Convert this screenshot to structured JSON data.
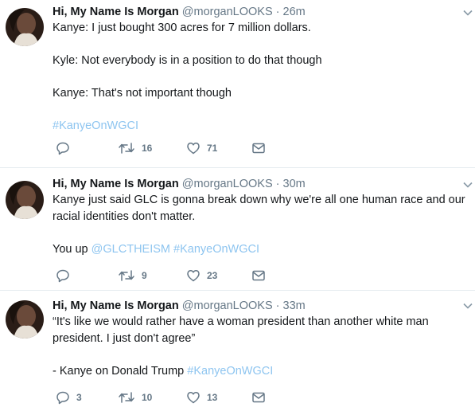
{
  "tweets": [
    {
      "name": "Hi, My Name Is Morgan",
      "handle": "@morganLOOKS",
      "dot": "·",
      "time": "26m",
      "paragraphs": [
        [
          "Kanye: I just bought 300 acres for 7 million dollars."
        ],
        [
          "Kyle: Not everybody is in a position to do that though"
        ],
        [
          "Kanye: That's not important though"
        ]
      ],
      "hashtag_line": "#KanyeOnWGCI",
      "reply_count": "",
      "retweet_count": "16",
      "like_count": "71"
    },
    {
      "name": "Hi, My Name Is Morgan",
      "handle": "@morganLOOKS",
      "dot": "·",
      "time": "30m",
      "line1": "Kanye just said GLC is gonna break down why we're all one human race and our",
      "line2": "racial identities don't matter.",
      "you_up": "You up",
      "mention": "@GLCTHEISM",
      "hashtag": "#KanyeOnWGCI",
      "reply_count": "",
      "retweet_count": "9",
      "like_count": "23"
    },
    {
      "name": "Hi, My Name Is Morgan",
      "handle": "@morganLOOKS",
      "dot": "·",
      "time": "33m",
      "line1": "“It's like we would rather have a woman president than another white man",
      "line2": "president. I just don't agree”",
      "attribution": "- Kanye on Donald Trump",
      "hashtag": "#KanyeOnWGCI",
      "reply_count": "3",
      "retweet_count": "10",
      "like_count": "13"
    }
  ],
  "icons": {
    "reply": "reply-icon",
    "retweet": "retweet-icon",
    "like": "heart-icon",
    "dm": "envelope-icon",
    "caret": "chevron-down-icon"
  },
  "colors": {
    "link": "#8ec5f0",
    "muted": "#657786",
    "text": "#14171a",
    "divider": "#e6ecf0"
  }
}
